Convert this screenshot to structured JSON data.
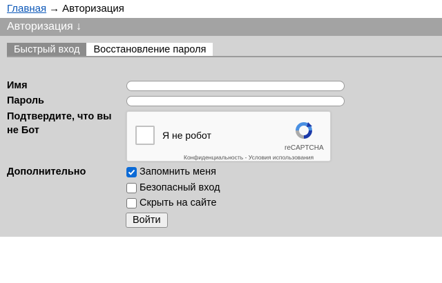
{
  "breadcrumb": {
    "home": "Главная",
    "separator": "→",
    "current": "Авторизация"
  },
  "header": {
    "title": "Авторизация ↓"
  },
  "tabs": [
    {
      "label": "Быстрый вход",
      "active": true
    },
    {
      "label": "Восстановление пароля",
      "active": false
    }
  ],
  "form": {
    "name_label": "Имя",
    "name_value": "",
    "password_label": "Пароль",
    "password_value": "",
    "captcha_label_line1": "Подтвердите, что вы",
    "captcha_label_line2": "не Бот",
    "extra_label": "Дополнительно",
    "submit_label": "Войти"
  },
  "recaptcha": {
    "checkbox_label": "Я не робот",
    "brand": "reCAPTCHA",
    "terms": "Конфиденциальность - Условия использования",
    "icon": "recaptcha-logo"
  },
  "options": [
    {
      "label": "Запомнить меня",
      "checked": true
    },
    {
      "label": "Безопасный вход",
      "checked": false
    },
    {
      "label": "Скрыть на сайте",
      "checked": false
    }
  ],
  "colors": {
    "header_bg": "#a3a3a3",
    "panel_bg": "#d3d3d3",
    "active_tab_bg": "#8c8c8c",
    "link": "#0b57b8",
    "checkbox_accent": "#0b6ad6"
  }
}
